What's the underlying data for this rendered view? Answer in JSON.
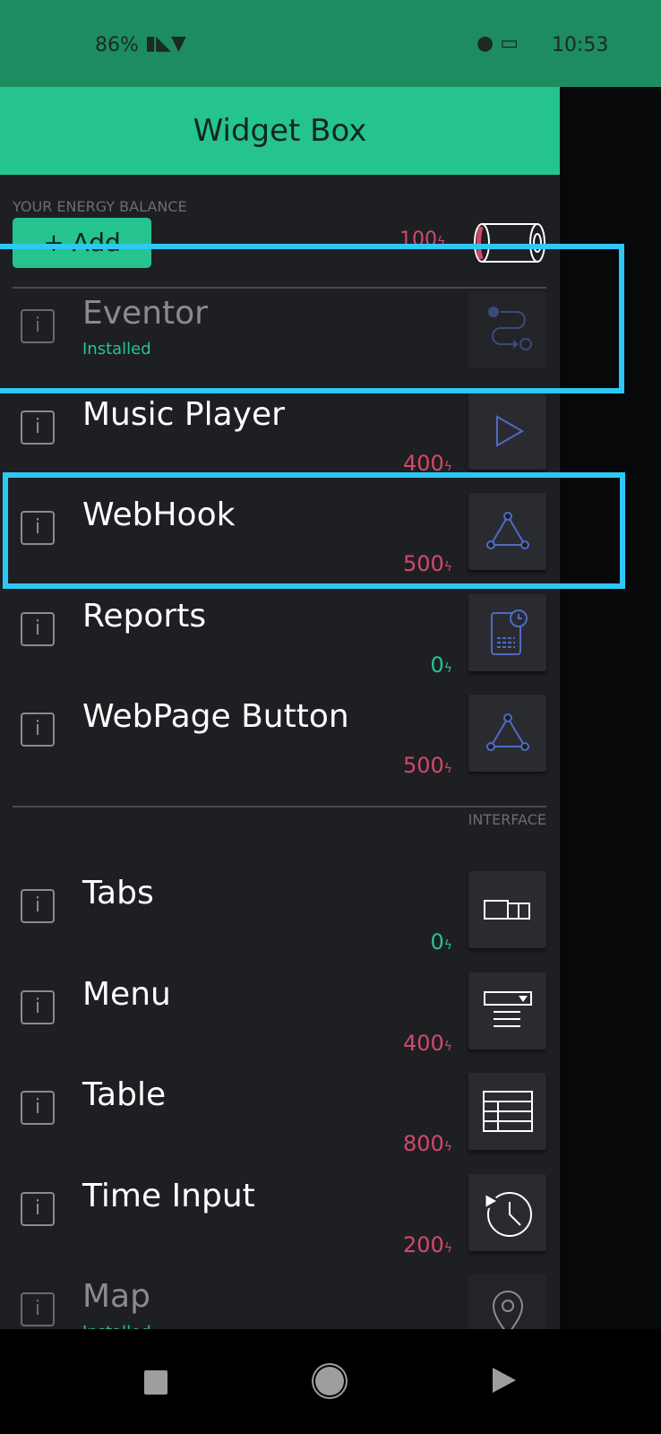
{
  "status_bar": {
    "battery": "86%",
    "time": "10:53"
  },
  "header": {
    "title": "Widget Box"
  },
  "energy": {
    "label": "YOUR ENERGY BALANCE",
    "add_label": "+ Add",
    "balance": "100",
    "bolt": "ϟ"
  },
  "section_interface": "INTERFACE",
  "colors": {
    "accent": "#25c48e",
    "price_red": "#d44868",
    "highlight": "#2ec8f7"
  },
  "widgets": [
    {
      "name": "Eventor",
      "status": "Installed",
      "icon": "eventor-icon",
      "dim": true
    },
    {
      "name": "Music Player",
      "price": "400",
      "icon": "play-icon"
    },
    {
      "name": "WebHook",
      "price": "500",
      "icon": "webhook-icon"
    },
    {
      "name": "Reports",
      "price": "0",
      "icon": "report-icon"
    },
    {
      "name": "WebPage Button",
      "price": "500",
      "icon": "webhook-icon"
    }
  ],
  "interface_widgets": [
    {
      "name": "Tabs",
      "price": "0",
      "icon": "tabs-icon"
    },
    {
      "name": "Menu",
      "price": "400",
      "icon": "menu-icon"
    },
    {
      "name": "Table",
      "price": "800",
      "icon": "table-icon"
    },
    {
      "name": "Time Input",
      "price": "200",
      "icon": "time-input-icon"
    },
    {
      "name": "Map",
      "status": "Installed",
      "icon": "map-pin-icon",
      "dim": true
    }
  ]
}
